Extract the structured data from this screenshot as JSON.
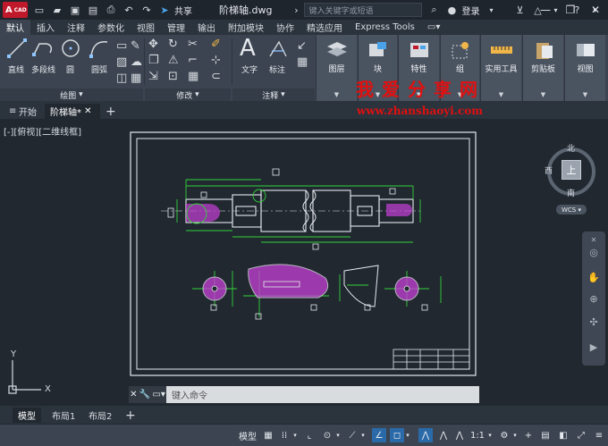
{
  "titlebar": {
    "app_logo": "A",
    "app_logo_sub": "CAD",
    "share": "共享",
    "doc_title": "阶梯轴.dwg",
    "search_placeholder": "键入关键字或短语",
    "login": "登录"
  },
  "ribbon_tabs": [
    "默认",
    "插入",
    "注释",
    "参数化",
    "视图",
    "管理",
    "输出",
    "附加模块",
    "协作",
    "精选应用",
    "Express Tools"
  ],
  "ribbon": {
    "draw": {
      "line": "直线",
      "polyline": "多段线",
      "circle": "圆",
      "arc": "圆弧",
      "title": "绘图"
    },
    "modify": {
      "title": "修改"
    },
    "annotation": {
      "text": "文字",
      "dimension": "标注",
      "title": "注释"
    },
    "layers": "图层",
    "block": "块",
    "properties": "特性",
    "group": "组",
    "utilities": "实用工具",
    "clipboard": "剪贴板",
    "view": "视图"
  },
  "watermark": {
    "cn": "我爱分享网",
    "url": "www.zhanshaoyi.com"
  },
  "file_tabs": {
    "start": "开始",
    "active": "阶梯轴*"
  },
  "viewport": {
    "label": "[-][俯视][二维线框]",
    "viewcube": {
      "north": "北",
      "south": "南",
      "west": "西",
      "top": "上",
      "wcs": "WCS"
    },
    "ucs_x": "X",
    "ucs_y": "Y"
  },
  "command": {
    "placeholder": "键入命令"
  },
  "layout_tabs": [
    "模型",
    "布局1",
    "布局2"
  ],
  "status": {
    "model": "模型",
    "scale": "1:1"
  },
  "colors": {
    "accent": "#2b6aa8",
    "logo": "#c0192b",
    "watermark": "#e01010",
    "draw_green": "#33d23a",
    "hatch": "#c53fd6"
  }
}
